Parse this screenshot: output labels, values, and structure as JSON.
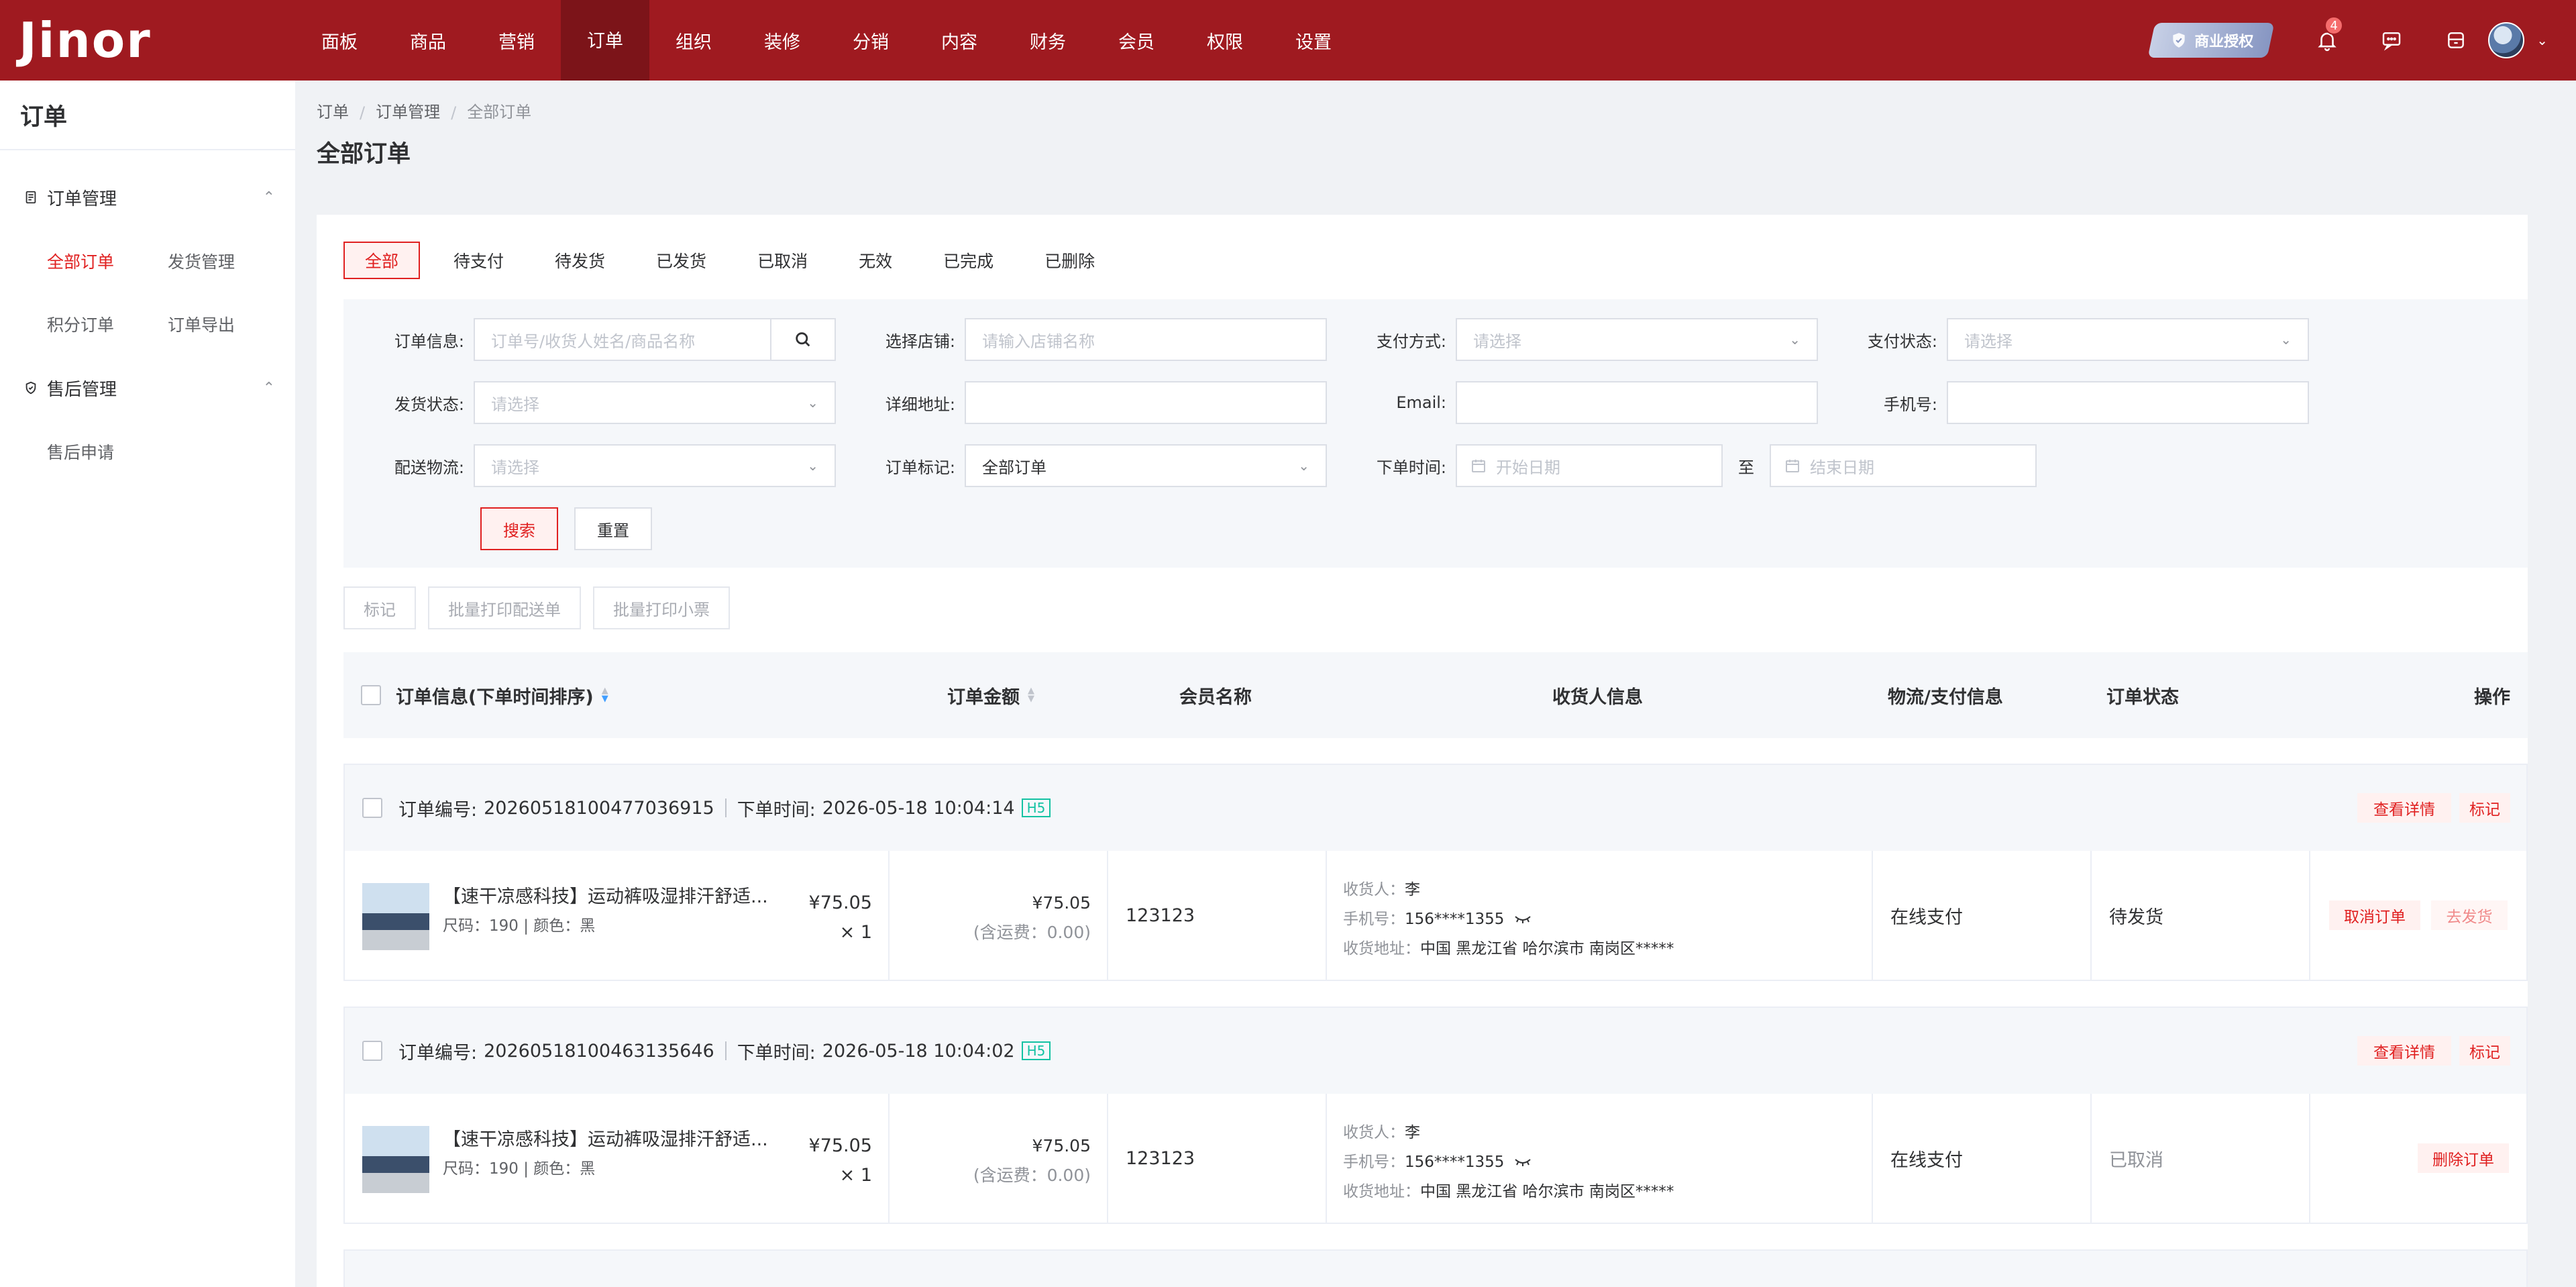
{
  "app": {
    "logo": "Jinor"
  },
  "topnav": {
    "items": [
      "面板",
      "商品",
      "营销",
      "订单",
      "组织",
      "装修",
      "分销",
      "内容",
      "财务",
      "会员",
      "权限",
      "设置"
    ],
    "active_index": 3,
    "license_label": "商业授权",
    "notification_count": "4"
  },
  "sidebar": {
    "title": "订单",
    "groups": [
      {
        "label": "订单管理",
        "links": [
          "全部订单",
          "发货管理",
          "积分订单",
          "订单导出"
        ]
      },
      {
        "label": "售后管理",
        "links": [
          "售后申请"
        ]
      }
    ]
  },
  "breadcrumb": [
    "订单",
    "订单管理",
    "全部订单"
  ],
  "page_title": "全部订单",
  "tabs": [
    "全部",
    "待支付",
    "待发货",
    "已发货",
    "已取消",
    "无效",
    "已完成",
    "已删除"
  ],
  "filters": {
    "order_info_label": "订单信息:",
    "order_info_placeholder": "订单号/收货人姓名/商品名称",
    "store_label": "选择店铺:",
    "store_placeholder": "请输入店铺名称",
    "pay_method_label": "支付方式:",
    "pay_method_placeholder": "请选择",
    "pay_status_label": "支付状态:",
    "pay_status_placeholder": "请选择",
    "ship_status_label": "发货状态:",
    "ship_status_placeholder": "请选择",
    "address_label": "详细地址:",
    "email_label": "Email:",
    "phone_label": "手机号:",
    "logistics_label": "配送物流:",
    "logistics_placeholder": "请选择",
    "order_mark_label": "订单标记:",
    "order_mark_value": "全部订单",
    "order_time_label": "下单时间:",
    "start_date_placeholder": "开始日期",
    "to_label": "至",
    "end_date_placeholder": "结束日期",
    "search_button": "搜索",
    "reset_button": "重置"
  },
  "batch_actions": [
    "标记",
    "批量打印配送单",
    "批量打印小票"
  ],
  "table": {
    "headers": {
      "order_info": "订单信息(下单时间排序)",
      "amount": "订单金额",
      "member": "会员名称",
      "receiver": "收货人信息",
      "logistics": "物流/支付信息",
      "status": "订单状态",
      "ops": "操作"
    }
  },
  "orders": [
    {
      "order_no_label": "订单编号:",
      "order_no": "20260518100477036915",
      "time_label": "下单时间:",
      "time": "2026-05-18 10:04:14",
      "platform": "H5",
      "view_detail": "查看详情",
      "mark": "标记",
      "product_title": "【速干凉感科技】运动裤吸湿排汗舒适...",
      "product_spec": "尺码：190 | 颜色：黑",
      "unit_price": "¥75.05",
      "qty": "× 1",
      "total": "¥75.05",
      "shipping_fee": "(含运费：0.00)",
      "member": "123123",
      "receiver_label": "收货人：",
      "receiver": "李",
      "phone_label": "手机号：",
      "phone": "156****1355",
      "address_label": "收货地址：",
      "address": "中国 黑龙江省 哈尔滨市 南岗区*****",
      "payment": "在线支付",
      "status": "待发货",
      "ops": [
        "取消订单",
        "去发货"
      ]
    },
    {
      "order_no_label": "订单编号:",
      "order_no": "20260518100463135646",
      "time_label": "下单时间:",
      "time": "2026-05-18 10:04:02",
      "platform": "H5",
      "view_detail": "查看详情",
      "mark": "标记",
      "product_title": "【速干凉感科技】运动裤吸湿排汗舒适...",
      "product_spec": "尺码：190 | 颜色：黑",
      "unit_price": "¥75.05",
      "qty": "× 1",
      "total": "¥75.05",
      "shipping_fee": "(含运费：0.00)",
      "member": "123123",
      "receiver_label": "收货人：",
      "receiver": "李",
      "phone_label": "手机号：",
      "phone": "156****1355",
      "address_label": "收货地址：",
      "address": "中国 黑龙江省 哈尔滨市 南岗区*****",
      "payment": "在线支付",
      "status": "已取消",
      "ops": [
        "删除订单"
      ]
    }
  ],
  "colors": {
    "brand": "#9f1a20",
    "accent": "#e02020",
    "h5_tag": "#13c2a3"
  }
}
